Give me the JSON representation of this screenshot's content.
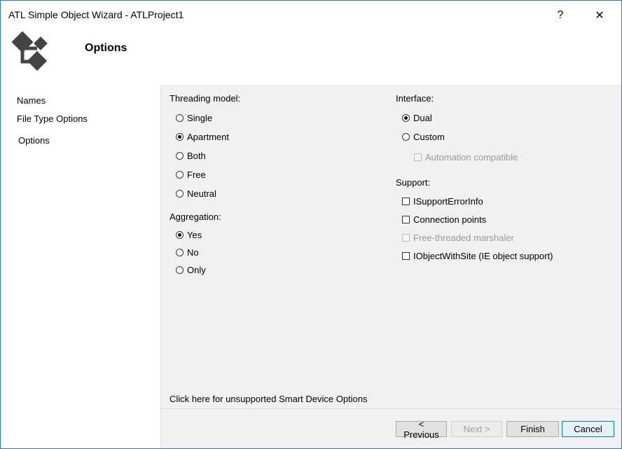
{
  "window": {
    "title": "ATL Simple Object Wizard - ATLProject1",
    "help_label": "?",
    "close_label": "✕"
  },
  "header": {
    "heading": "Options",
    "logo_icon": "atl-wizard-icon"
  },
  "nav": {
    "items": [
      {
        "label": "Names",
        "selected": false
      },
      {
        "label": "File Type Options",
        "selected": false
      },
      {
        "label": "Options",
        "selected": true
      }
    ]
  },
  "threading": {
    "label": "Threading model:",
    "options": [
      {
        "label": "Single",
        "checked": false
      },
      {
        "label": "Apartment",
        "checked": true
      },
      {
        "label": "Both",
        "checked": false
      },
      {
        "label": "Free",
        "checked": false
      },
      {
        "label": "Neutral",
        "checked": false
      }
    ]
  },
  "aggregation": {
    "label": "Aggregation:",
    "options": [
      {
        "label": "Yes",
        "checked": true
      },
      {
        "label": "No",
        "checked": false
      },
      {
        "label": "Only",
        "checked": false
      }
    ]
  },
  "interface": {
    "label": "Interface:",
    "options": [
      {
        "label": "Dual",
        "checked": true
      },
      {
        "label": "Custom",
        "checked": false
      }
    ],
    "automation_label": "Automation compatible"
  },
  "support": {
    "label": "Support:",
    "options": [
      {
        "label": "ISupportErrorInfo",
        "checked": false,
        "enabled": true
      },
      {
        "label": "Connection points",
        "checked": false,
        "enabled": true
      },
      {
        "label": "Free-threaded marshaler",
        "checked": false,
        "enabled": false
      },
      {
        "label": "IObjectWithSite (IE object support)",
        "checked": false,
        "enabled": true
      }
    ]
  },
  "smart_device_link": "Click here for unsupported Smart Device Options",
  "buttons": {
    "previous": "< Previous",
    "next": "Next >",
    "finish": "Finish",
    "cancel": "Cancel"
  },
  "colors": {
    "window_border": "#2b79c9",
    "panel_bg": "#f0f0f0",
    "accent": "#0078d7"
  }
}
